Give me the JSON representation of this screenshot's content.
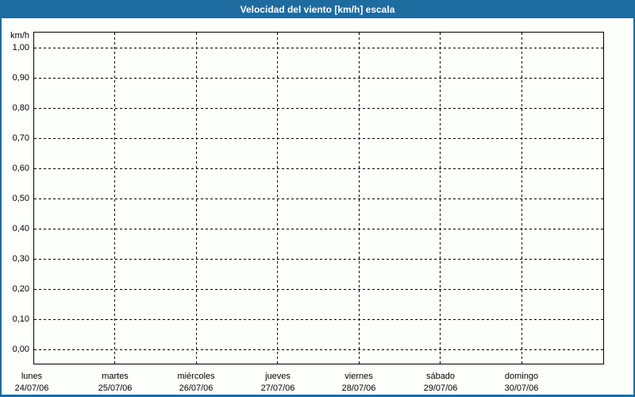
{
  "title_bar": {
    "text": "Velocidad del viento [km/h] escala"
  },
  "colors": {
    "frame_blue": "#1e6ba0",
    "background": "#fdfffd",
    "plot_border": "#000000",
    "grid": "#000000",
    "title_text": "#ffffff"
  },
  "chart_data": {
    "type": "line",
    "title": "Velocidad del viento [km/h] escala",
    "ylabel": "km/h",
    "xlabel": "",
    "ylim": [
      0.0,
      1.0
    ],
    "grid": "dashed",
    "legend": "none",
    "y_axis": {
      "unit_label": "km/h",
      "tick_labels": [
        "1,00",
        "0,90",
        "0,80",
        "0,70",
        "0,60",
        "0,50",
        "0,40",
        "0,30",
        "0,20",
        "0,10",
        "0,00"
      ],
      "tick_values": [
        1.0,
        0.9,
        0.8,
        0.7,
        0.6,
        0.5,
        0.4,
        0.3,
        0.2,
        0.1,
        0.0
      ]
    },
    "x_axis": {
      "days": [
        {
          "name": "lunes",
          "date": "24/07/06"
        },
        {
          "name": "martes",
          "date": "25/07/06"
        },
        {
          "name": "miércoles",
          "date": "26/07/06"
        },
        {
          "name": "jueves",
          "date": "27/07/06"
        },
        {
          "name": "viernes",
          "date": "28/07/06"
        },
        {
          "name": "sábado",
          "date": "29/07/06"
        },
        {
          "name": "domingo",
          "date": "30/07/06"
        }
      ]
    },
    "series": []
  }
}
